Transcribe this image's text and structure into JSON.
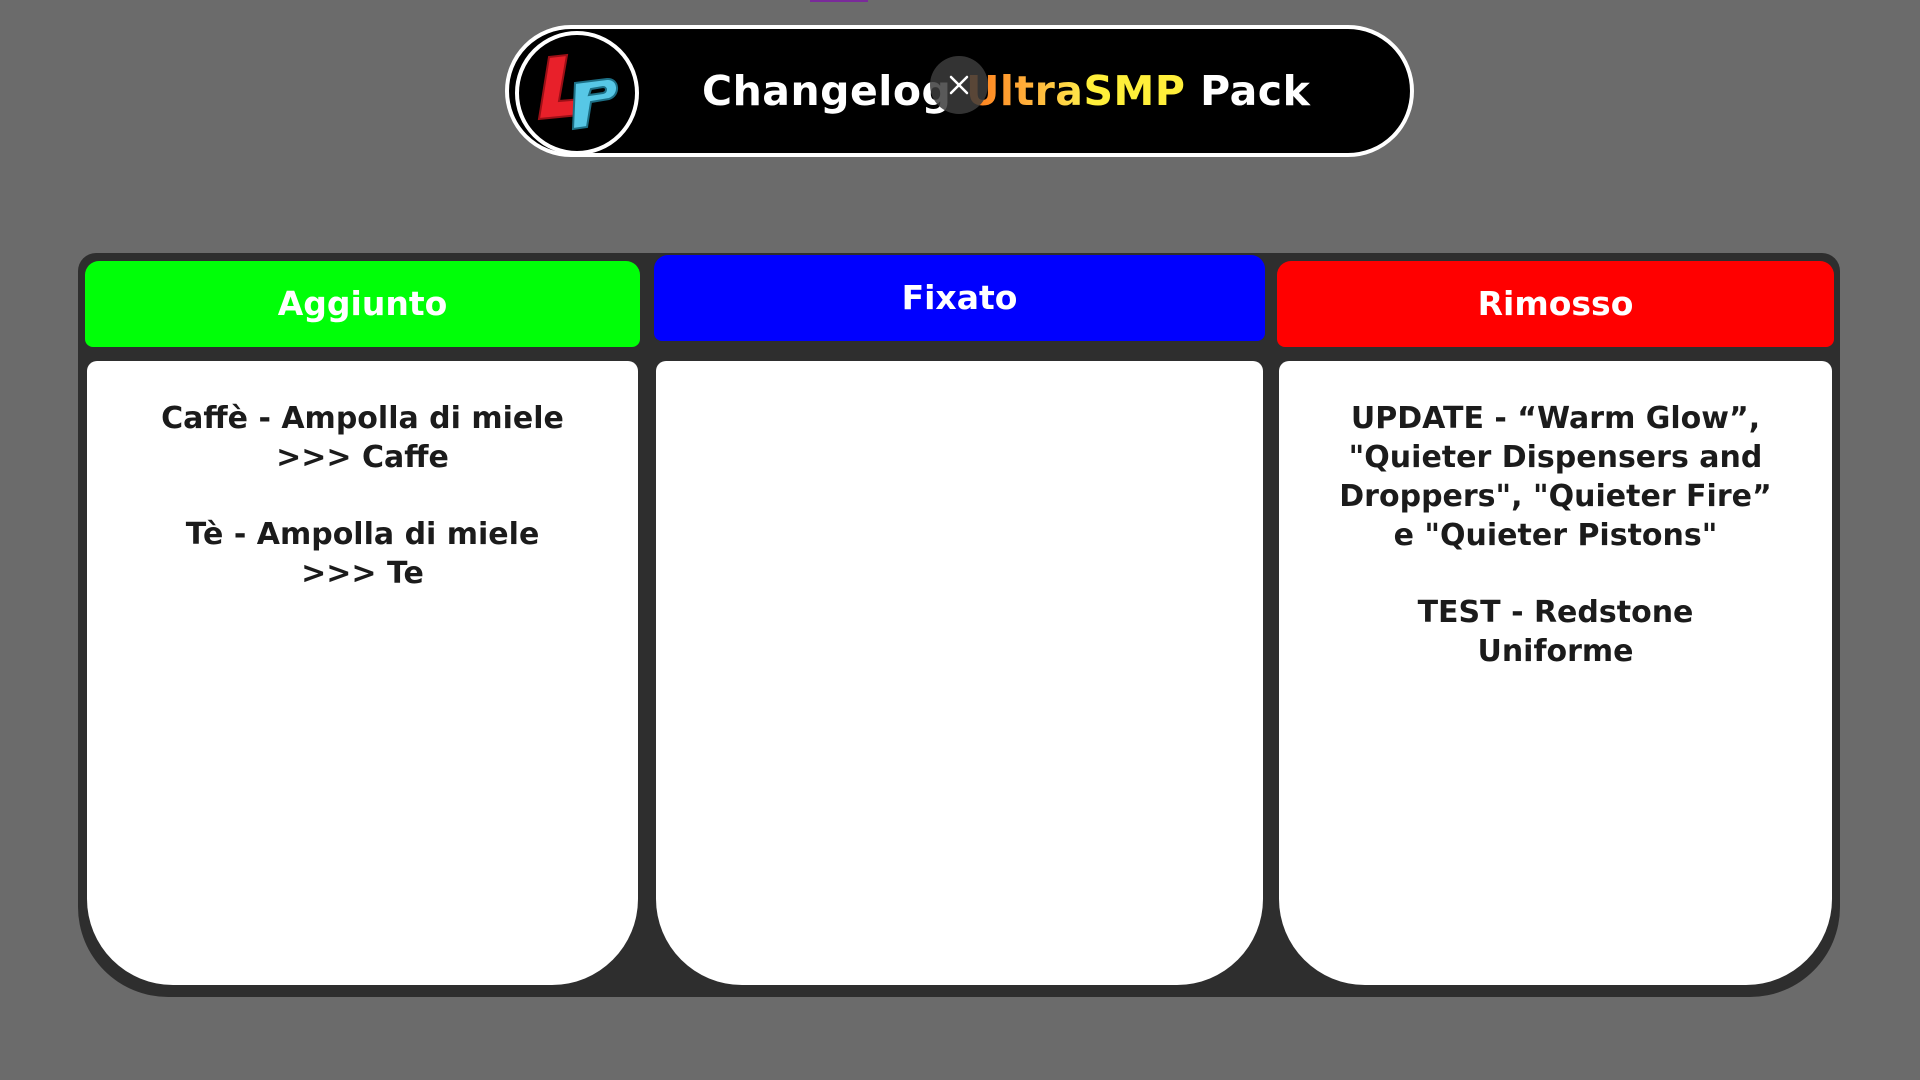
{
  "header": {
    "logo_icon": "lp-logo-icon",
    "title_prefix": "Changelog ",
    "title_ultra": "Ultra",
    "title_smp": "SMP",
    "title_suffix": " Pack",
    "close_icon": "close-icon"
  },
  "columns": [
    {
      "title": "Aggiunto",
      "color": "#00ff08",
      "entries": [
        "Caffè - Ampolla di miele\n>>> Caffe",
        "Tè - Ampolla di miele\n>>> Te"
      ]
    },
    {
      "title": "Fixato",
      "color": "#0000ff",
      "entries": []
    },
    {
      "title": "Rimosso",
      "color": "#ff0000",
      "entries": [
        "UPDATE - “Warm Glow”,\n\"Quieter Dispensers and\nDroppers\", \"Quieter Fire”\ne \"Quieter Pistons\"",
        "TEST - Redstone\nUniforme"
      ]
    }
  ],
  "colors": {
    "background": "#6b6b6b",
    "pill": "#000000",
    "board_border": "#2e2e2e"
  }
}
